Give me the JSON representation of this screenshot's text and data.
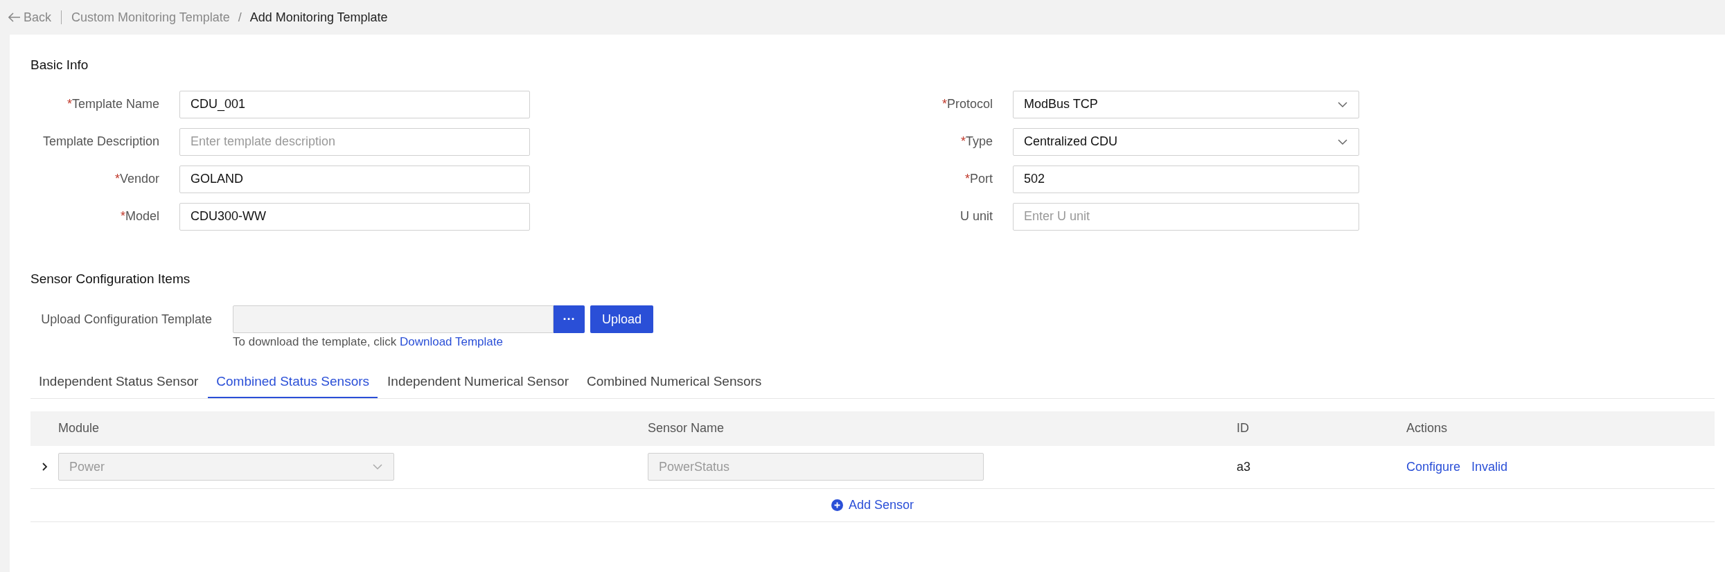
{
  "breadcrumb": {
    "back": "Back",
    "items": [
      {
        "label": "Custom Monitoring Template",
        "current": false
      },
      {
        "label": "Add Monitoring Template",
        "current": true
      }
    ],
    "separator": "/"
  },
  "basic_info": {
    "title": "Basic Info",
    "left_fields": [
      {
        "label": "Template Name",
        "asterisk": "*",
        "kind": "text",
        "value": "CDU_001"
      },
      {
        "label": "Template Description",
        "kind": "text",
        "placeholder": "Enter template description"
      },
      {
        "label": "Vendor",
        "asterisk": "*",
        "kind": "text",
        "value": "GOLAND"
      },
      {
        "label": "Model",
        "asterisk": "*",
        "kind": "text",
        "value": "CDU300-WW"
      }
    ],
    "right_fields": [
      {
        "label": "Protocol",
        "asterisk": "*",
        "kind": "select",
        "value": "ModBus TCP"
      },
      {
        "label": "Type",
        "asterisk": "*",
        "kind": "select",
        "value": "Centralized CDU"
      },
      {
        "label": "Port",
        "asterisk": "*",
        "kind": "text",
        "value": "502"
      },
      {
        "label": "U unit",
        "kind": "text",
        "placeholder": "Enter U unit"
      }
    ]
  },
  "sensor_config": {
    "title": "Sensor Configuration Items",
    "upload_label": "Upload Configuration Template",
    "browse_button": "···",
    "upload_button": "Upload",
    "hint": "To download the template, click",
    "hint_link": "Download Template",
    "tabs": [
      {
        "label": "Independent Status Sensor",
        "selected": false
      },
      {
        "label": "Combined Status Sensors",
        "selected": true
      },
      {
        "label": "Independent Numerical Sensor",
        "selected": false
      },
      {
        "label": "Combined Numerical Sensors",
        "selected": false
      }
    ],
    "table": {
      "columns": [
        "Module",
        "Sensor Name",
        "ID",
        "Actions"
      ],
      "rows": [
        {
          "expanded": false,
          "module": "Power",
          "sensor_name": "PowerStatus",
          "id": "a3",
          "actions": [
            "Configure",
            "Invalid"
          ],
          "disabled": true
        }
      ]
    },
    "add_sensor": "Add Sensor"
  }
}
